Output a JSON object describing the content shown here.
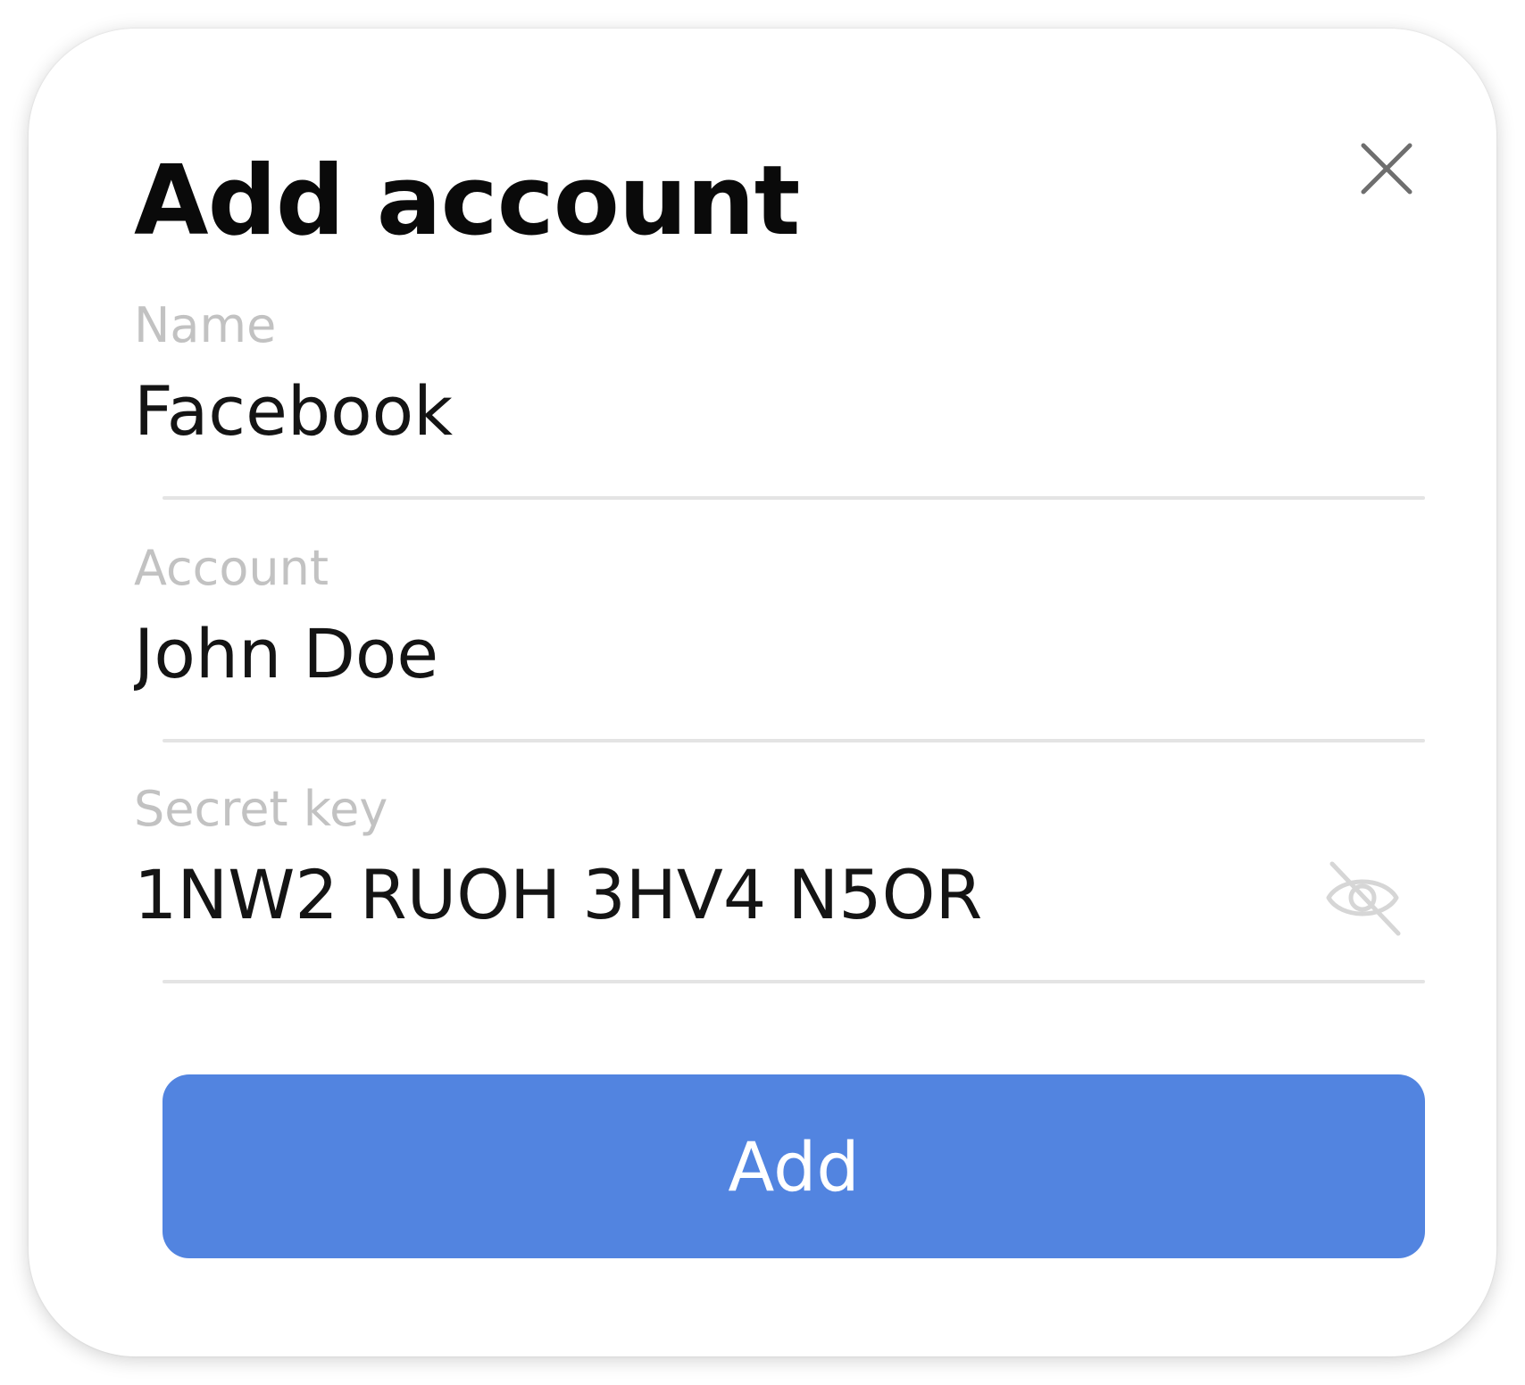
{
  "dialog": {
    "title": "Add account",
    "close_icon": "close-icon"
  },
  "fields": {
    "name": {
      "label": "Name",
      "value": "Facebook"
    },
    "account": {
      "label": "Account",
      "value": "John Doe"
    },
    "secret_key": {
      "label": "Secret key",
      "value": "1NW2 RUOH 3HV4 N5OR",
      "toggle_icon": "eye-off-icon"
    }
  },
  "actions": {
    "add_label": "Add"
  },
  "colors": {
    "accent": "#5284e0",
    "label": "#c2c2c2",
    "text": "#141414",
    "divider": "#e4e4e4"
  }
}
